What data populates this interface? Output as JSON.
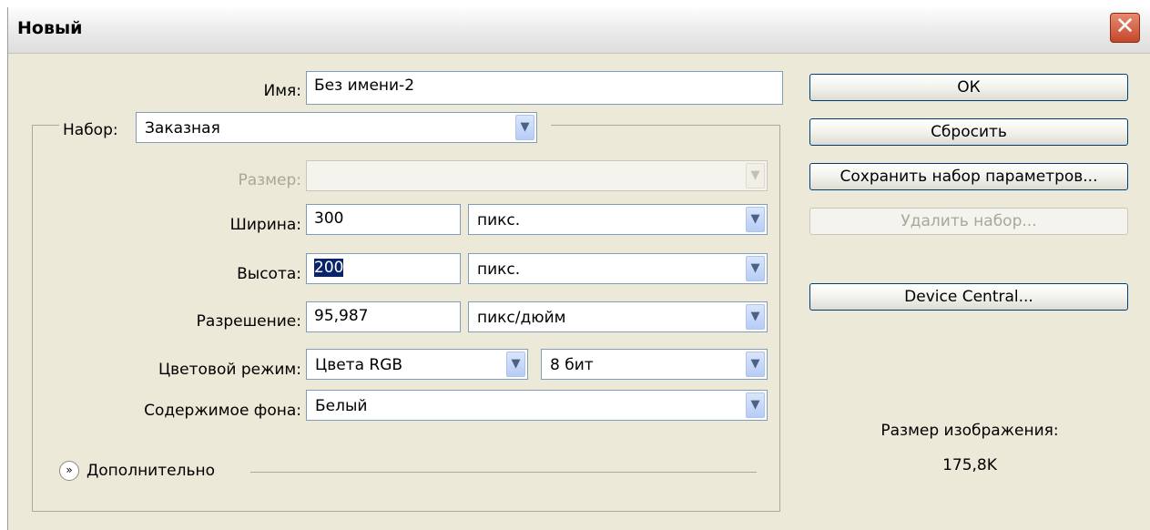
{
  "window": {
    "title": "Новый"
  },
  "form": {
    "name": {
      "label": "Имя:",
      "value": "Без имени-2"
    },
    "preset": {
      "label": "Набор:",
      "value": "Заказная"
    },
    "size": {
      "label": "Размер:",
      "value": ""
    },
    "width": {
      "label": "Ширина:",
      "value": "300",
      "unit": "пикс."
    },
    "height": {
      "label": "Высота:",
      "value": "200",
      "unit": "пикс."
    },
    "resolution": {
      "label": "Разрешение:",
      "value": "95,987",
      "unit": "пикс/дюйм"
    },
    "color_mode": {
      "label": "Цветовой режим:",
      "value": "Цвета RGB",
      "depth": "8 бит"
    },
    "background": {
      "label": "Содержимое фона:",
      "value": "Белый"
    },
    "advanced": {
      "label": "Дополнительно"
    }
  },
  "buttons": {
    "ok": "ОК",
    "reset": "Сбросить",
    "save_preset": "Сохранить набор параметров...",
    "delete_preset": "Удалить набор...",
    "device_central": "Device Central..."
  },
  "image_size": {
    "label": "Размер изображения:",
    "value": "175,8K"
  }
}
